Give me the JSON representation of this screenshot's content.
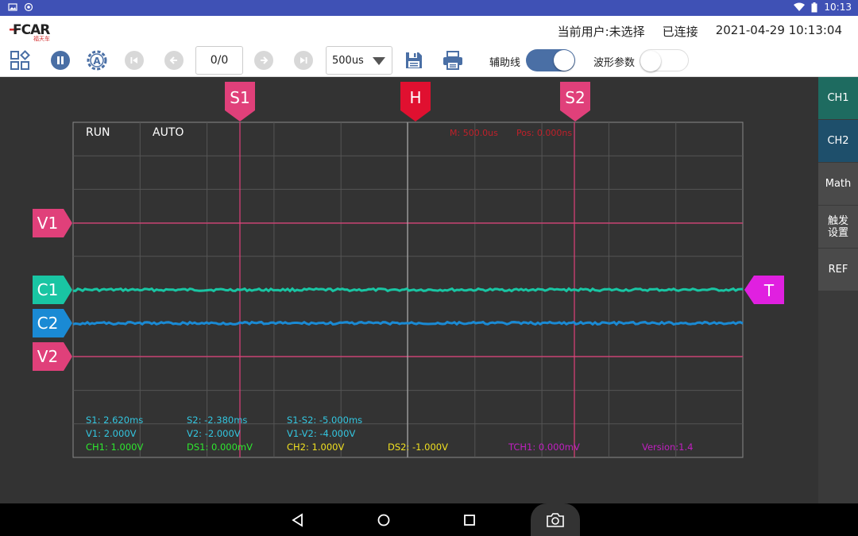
{
  "statusbar": {
    "time": "10:13"
  },
  "header": {
    "logo_text": "FCAR",
    "logo_sub": "福天车",
    "user": "当前用户:未选择",
    "connection": "已连接",
    "datetime": "2021-04-29 10:13:04"
  },
  "toolbar": {
    "counter": "0/0",
    "timebase": "500us",
    "helper_lines_label": "辅助线",
    "helper_lines_on": true,
    "wave_params_label": "波形参数",
    "wave_params_on": false
  },
  "scope": {
    "run_state": "RUN",
    "trigger_mode": "AUTO",
    "timebase_readout": "M: 500.0us",
    "position_readout": "Pos: 0.000ns",
    "markers": {
      "s1": "S1",
      "h": "H",
      "s2": "S2",
      "v1": "V1",
      "c1": "C1",
      "c2": "C2",
      "v2": "V2",
      "t": "T"
    },
    "readouts": {
      "s1": "S1: 2.620ms",
      "s2": "S2: -2.380ms",
      "s1_s2": "S1-S2: -5.000ms",
      "v1": "V1: 2.000V",
      "v2": "V2: -2.000V",
      "v1_v2": "V1-V2: -4.000V",
      "ch1": "CH1: 1.000V",
      "ds1": "DS1: 0.000mV",
      "ch2": "CH2: 1.000V",
      "ds2": "DS2: -1.000V",
      "tch1": "TCH1: 0.000mV",
      "version": "Version:1.4"
    }
  },
  "sidepanel": {
    "ch1": "CH1",
    "ch2": "CH2",
    "math": "Math",
    "trigger_line1": "触发",
    "trigger_line2": "设置",
    "ref": "REF"
  },
  "colors": {
    "accent": "#3f51b5",
    "ch1": "#19c5a3",
    "ch2": "#1a8ad4",
    "cursor": "#e0407a",
    "trigger": "#e020e0",
    "side_ch1": "#1e6b60",
    "side_ch2": "#1e4f6b"
  }
}
